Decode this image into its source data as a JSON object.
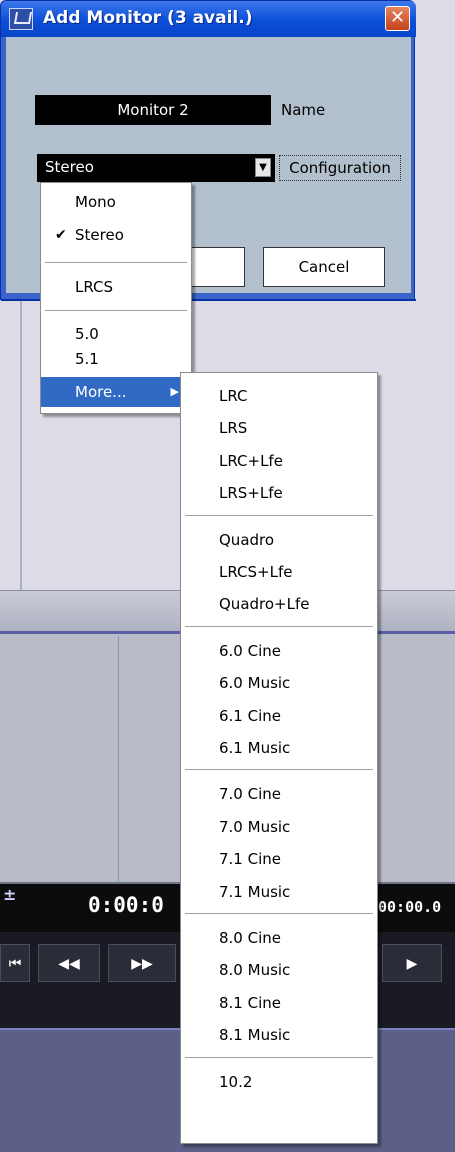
{
  "dialog": {
    "title": "Add Monitor (3 avail.)",
    "close_symbol": "✕",
    "name_value": "Monitor 2",
    "name_label": "Name",
    "configuration_value": "Stereo",
    "configuration_label": "Configuration",
    "cancel_label": "Cancel"
  },
  "menu": {
    "items": [
      {
        "label": "Mono",
        "checked": false
      },
      {
        "label": "Stereo",
        "checked": true
      },
      {
        "label": "LRCS",
        "checked": false
      },
      {
        "label": "5.0",
        "checked": false
      },
      {
        "label": "5.1",
        "checked": false
      },
      {
        "label": "More...",
        "checked": false
      }
    ],
    "check_symbol": "✔",
    "submenu_arrow": "▶"
  },
  "submenu": {
    "groups": [
      [
        "LRC",
        "LRS",
        "LRC+Lfe",
        "LRS+Lfe"
      ],
      [
        "Quadro",
        "LRCS+Lfe",
        "Quadro+Lfe"
      ],
      [
        "6.0 Cine",
        "6.0 Music",
        "6.1 Cine",
        "6.1 Music"
      ],
      [
        "7.0 Cine",
        "7.0 Music",
        "7.1 Cine",
        "7.1 Music"
      ],
      [
        "8.0 Cine",
        "8.0 Music",
        "8.1 Cine",
        "8.1 Music"
      ],
      [
        "10.2"
      ]
    ]
  },
  "transport": {
    "time_primary": "0:00:0",
    "time_secondary": "00:00.0",
    "marker": "±",
    "buttons": [
      "⏮",
      "◀◀",
      "▶▶",
      "▶"
    ]
  },
  "colors": {
    "selection": "#316ac5",
    "titlebar": "#0a4ed8",
    "dialog_body": "#b2bfcc"
  }
}
